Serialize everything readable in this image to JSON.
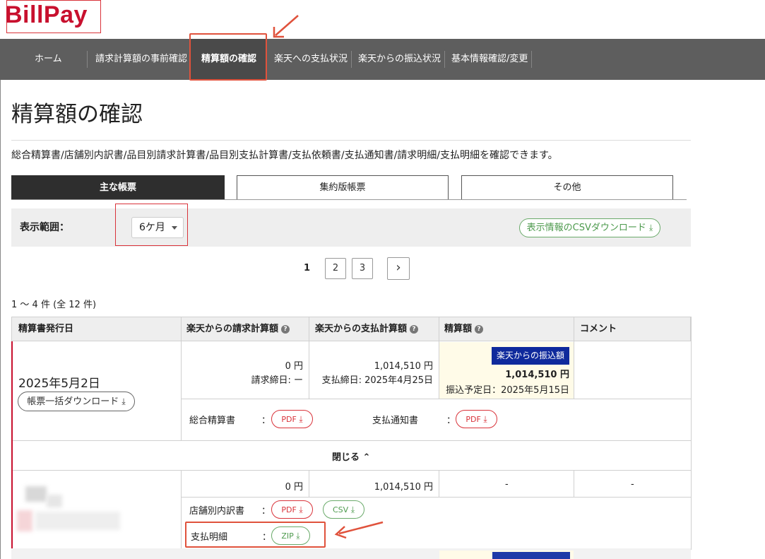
{
  "app": {
    "logo": "BillPay"
  },
  "nav": {
    "items": [
      {
        "label": "ホーム"
      },
      {
        "label": "請求計算額の事前確認"
      },
      {
        "label": "精算額の確認"
      },
      {
        "label": "楽天への支払状況"
      },
      {
        "label": "楽天からの振込状況"
      },
      {
        "label": "基本情報確認/変更"
      }
    ]
  },
  "page": {
    "title": "精算額の確認",
    "description": "総合精算書/店舗別内訳書/品目別請求計算書/品目別支払計算書/支払依頼書/支払通知書/請求明細/支払明細を確認できます。"
  },
  "tabs": [
    {
      "label": "主な帳票"
    },
    {
      "label": "集約版帳票"
    },
    {
      "label": "その他"
    }
  ],
  "filter": {
    "label": "表示範囲：",
    "selected": "6ケ月",
    "csv_button": "表示情報のCSVダウンロード"
  },
  "pager": {
    "current": "1",
    "pages": [
      "2",
      "3"
    ],
    "next": "›"
  },
  "result_count": "1 〜 4 件 (全 12 件)",
  "table": {
    "headers": [
      "精算書発行日",
      "楽天からの請求計算額",
      "楽天からの支払計算額",
      "精算額",
      "コメント"
    ],
    "row1": {
      "date": "2025年5月2日",
      "bulk_download": "帳票一括ダウンロード",
      "billing_amount": "0 円",
      "billing_cutoff": "請求締日: ー",
      "payment_amount": "1,014,510 円",
      "payment_cutoff": "支払締日: 2025年4月25日",
      "settle_badge": "楽天からの振込額",
      "settle_amount": "1,014,510 円",
      "settle_date": "振込予定日：2025年5月15日",
      "doc1_label": "総合精算書",
      "doc2_label": "支払通知書",
      "colon": "：",
      "pdf": "PDF",
      "close": "閉じる"
    },
    "row2": {
      "billing_amount": "0 円",
      "payment_amount": "1,014,510 円",
      "settle": "-",
      "comment": "-",
      "doc1_label": "店舗別内訳書",
      "doc2_label": "支払明細",
      "colon": "：",
      "pdf": "PDF",
      "csv": "CSV",
      "zip": "ZIP"
    }
  },
  "colors": {
    "brand": "#c8102e",
    "nav_bg": "#5e5e5e",
    "annotation": "#e0523c",
    "badge": "#0f2a9c",
    "settle_bg": "#fffbe8",
    "green": "#4d9a4d"
  }
}
